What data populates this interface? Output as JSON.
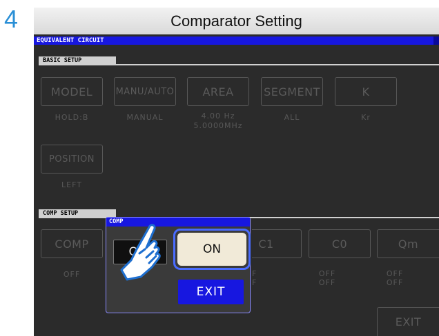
{
  "step_number": "4",
  "title": "Comparator Setting",
  "mode_bar": "EQUIVALENT CIRCUIT",
  "basic_setup": {
    "label": "BASIC SETUP",
    "buttons": [
      {
        "label": "MODEL",
        "value": "HOLD:B"
      },
      {
        "label": "MANU/AUTO",
        "value": "MANUAL"
      },
      {
        "label": "AREA",
        "value": "4.00 Hz",
        "value2": "5.0000MHz"
      },
      {
        "label": "SEGMENT",
        "value": "ALL"
      },
      {
        "label": "K",
        "value": "Kr"
      },
      {
        "label": "POSITION",
        "value": "LEFT"
      }
    ]
  },
  "comp_setup": {
    "label": "COMP SETUP",
    "buttons": [
      {
        "label": "COMP",
        "value": "OFF"
      },
      {
        "label": "C1",
        "value": "OFF",
        "value2": "OFF"
      },
      {
        "label": "C0",
        "value": "OFF",
        "value2": "OFF"
      },
      {
        "label": "Qm",
        "value": "OFF",
        "value2": "OFF"
      }
    ],
    "partial_value": "F",
    "exit_label": "EXIT"
  },
  "dialog": {
    "title": "COMP",
    "off_label": "OFF",
    "on_label": "ON",
    "exit_label": "EXIT"
  },
  "colors": {
    "mode_bar": "#1717e0",
    "screen_bg": "#2b2b2b",
    "on_highlight": "#4a6cff",
    "step_number": "#2a8fd6"
  }
}
